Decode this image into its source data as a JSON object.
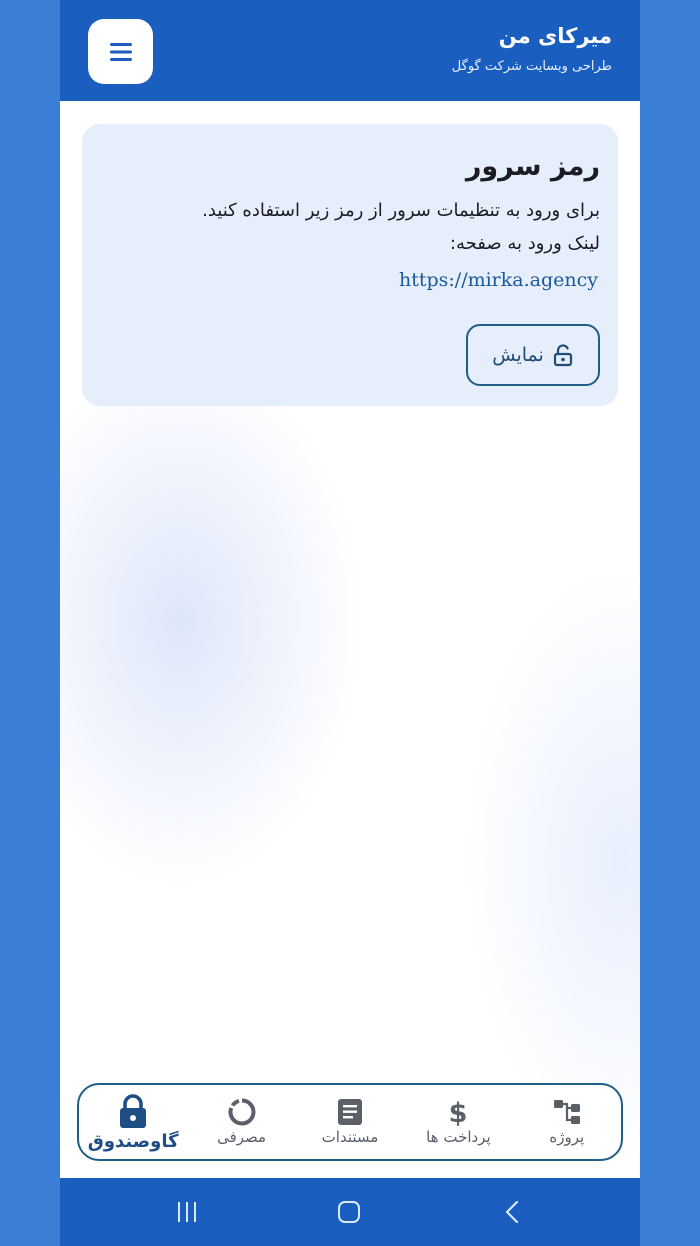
{
  "header": {
    "title": "میرکای من",
    "subtitle": "طراحی وبسایت شرکت گوگل",
    "menu_icon": "hamburger-menu-icon"
  },
  "card": {
    "title": "رمز سرور",
    "line1": "برای ورود به تنظیمات سرور از رمز زیر استفاده کنید.",
    "line2": "لینک ورود به صفحه:",
    "link": "https://mirka.agency",
    "show_button_label": "نمایش",
    "show_button_icon": "unlock-icon"
  },
  "bottom_nav": {
    "items": [
      {
        "label": "پروژه",
        "icon": "project-tree-icon",
        "active": false
      },
      {
        "label": "پرداخت ها",
        "icon": "dollar-icon",
        "active": false
      },
      {
        "label": "مستندات",
        "icon": "document-icon",
        "active": false
      },
      {
        "label": "مصرفی",
        "icon": "circle-progress-icon",
        "active": false
      },
      {
        "label": "گاوصندوق",
        "icon": "lock-icon",
        "active": true
      }
    ]
  },
  "colors": {
    "primary": "#1a5fbf",
    "outer_background": "#3a7fd5",
    "card_background": "#e7eefb",
    "border": "#1f5e86",
    "link": "#1a5a9a"
  },
  "system_nav": {
    "icons": [
      "recents-icon",
      "home-icon",
      "back-icon"
    ]
  }
}
